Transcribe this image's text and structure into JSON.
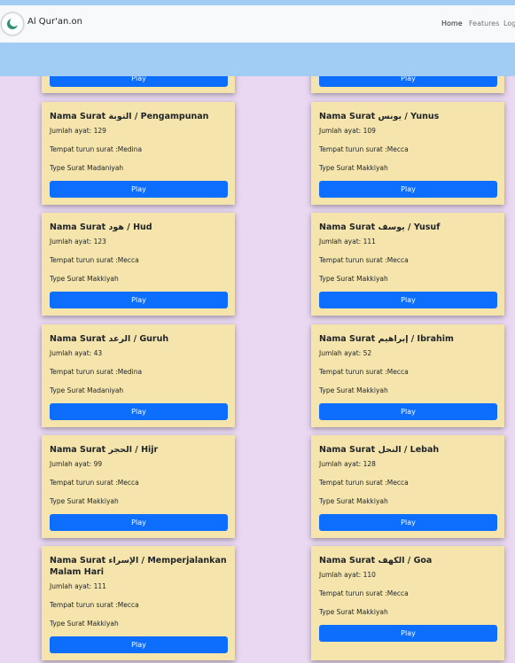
{
  "app": {
    "brand": "Al Qur'an.on",
    "nav": [
      "Home",
      "Features",
      "Log"
    ]
  },
  "labels": {
    "title_prefix": "Nama Surat",
    "ayat_prefix": "Jumlah ayat:",
    "tempat_prefix": "Tempat turun surat :",
    "type_prefix": "Type Surat",
    "play": "Play"
  },
  "surahs": [
    {
      "arabic": "التوبة",
      "latin": "Pengampunan",
      "ayat": 129,
      "tempat": "Medina",
      "type": "Madaniyah"
    },
    {
      "arabic": "يونس",
      "latin": "Yunus",
      "ayat": 109,
      "tempat": "Mecca",
      "type": "Makkiyah"
    },
    {
      "arabic": "هود",
      "latin": "Hud",
      "ayat": 123,
      "tempat": "Mecca",
      "type": "Makkiyah"
    },
    {
      "arabic": "يوسف",
      "latin": "Yusuf",
      "ayat": 111,
      "tempat": "Mecca",
      "type": "Makkiyah"
    },
    {
      "arabic": "الرعد",
      "latin": "Guruh",
      "ayat": 43,
      "tempat": "Medina",
      "type": "Madaniyah"
    },
    {
      "arabic": "إبراهيم",
      "latin": "Ibrahim",
      "ayat": 52,
      "tempat": "Mecca",
      "type": "Makkiyah"
    },
    {
      "arabic": "الحجر",
      "latin": "Hijr",
      "ayat": 99,
      "tempat": "Mecca",
      "type": "Makkiyah"
    },
    {
      "arabic": "النحل",
      "latin": "Lebah",
      "ayat": 128,
      "tempat": "Mecca",
      "type": "Makkiyah"
    },
    {
      "arabic": "الإسراء",
      "latin": "Memperjalankan Malam Hari",
      "ayat": 111,
      "tempat": "Mecca",
      "type": "Makkiyah"
    },
    {
      "arabic": "الكهف",
      "latin": "Goa",
      "ayat": 110,
      "tempat": "Mecca",
      "type": "Makkiyah"
    }
  ]
}
